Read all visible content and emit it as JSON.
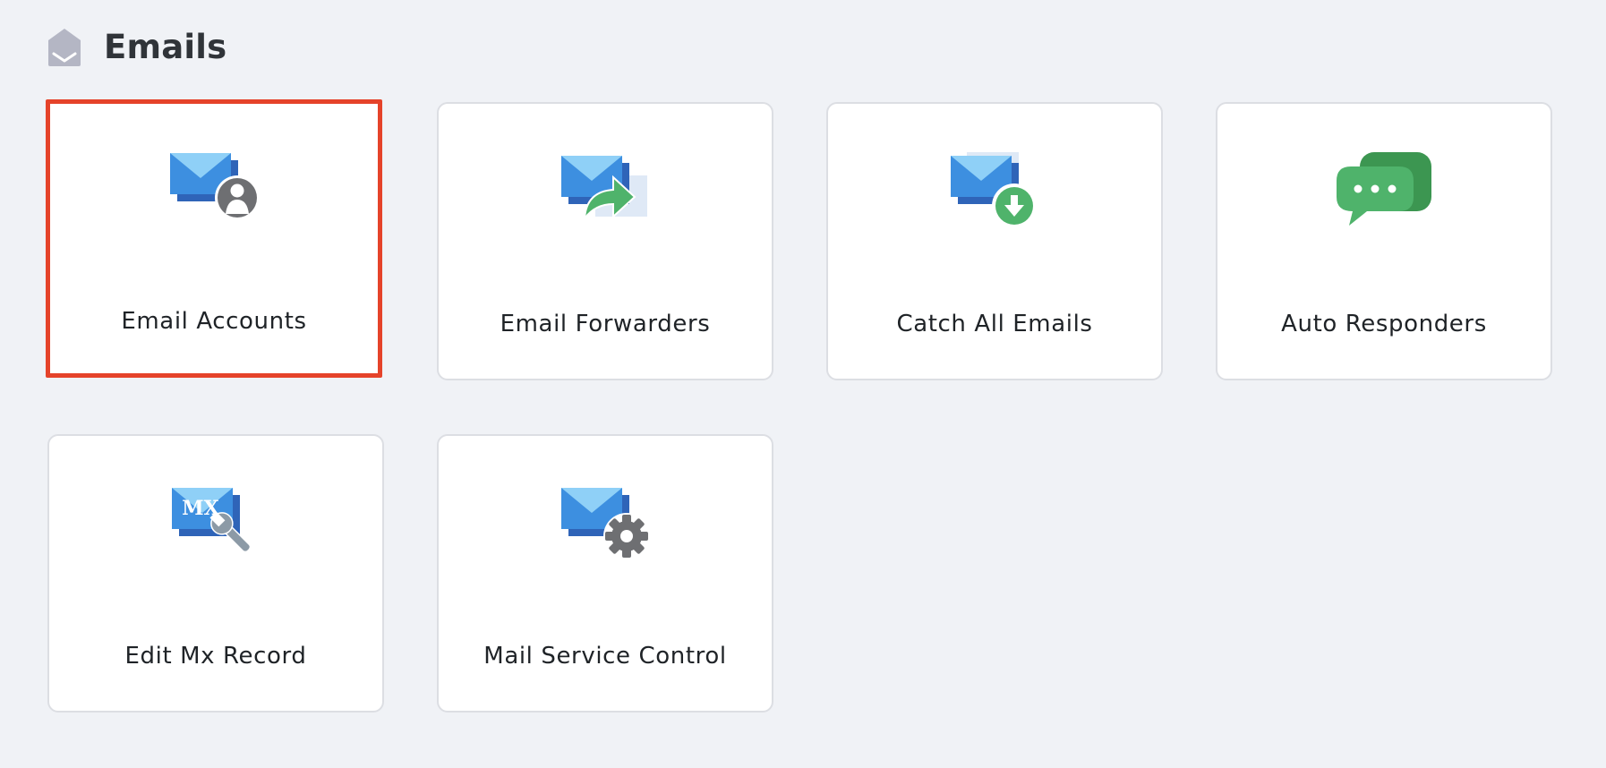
{
  "section": {
    "title": "Emails",
    "icon": "open-envelope-icon"
  },
  "cards": [
    {
      "label": "Email Accounts",
      "icon": "email-account-icon",
      "selected": true
    },
    {
      "label": "Email Forwarders",
      "icon": "email-forward-icon",
      "selected": false
    },
    {
      "label": "Catch All Emails",
      "icon": "email-download-icon",
      "selected": false
    },
    {
      "label": "Auto Responders",
      "icon": "chat-bubbles-icon",
      "selected": false
    },
    {
      "label": "Edit Mx Record",
      "icon": "mx-wrench-icon",
      "icon_text": "MX",
      "selected": false
    },
    {
      "label": "Mail Service Control",
      "icon": "mail-gear-icon",
      "selected": false
    }
  ],
  "colors": {
    "page_background": "#f0f2f6",
    "card_background": "#ffffff",
    "card_border": "#dcdee3",
    "selection_highlight": "#e5432a",
    "envelope_blue": "#3d8fe0",
    "envelope_flap": "#8fd0f7",
    "accent_green": "#4fb36b",
    "icon_gray": "#6e6f72",
    "header_icon": "#b4b6c4"
  }
}
